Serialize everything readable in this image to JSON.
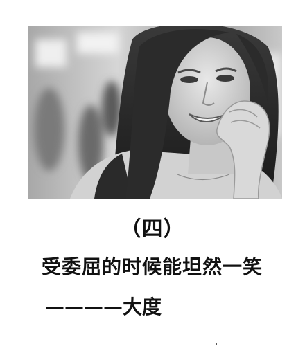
{
  "photo": {
    "subject": "black-and-white portrait of a smiling young woman with long hair, hand near chin"
  },
  "caption": {
    "number": "（四）",
    "line1": "受委屈的时候能坦然一笑",
    "line2": "————大度"
  }
}
